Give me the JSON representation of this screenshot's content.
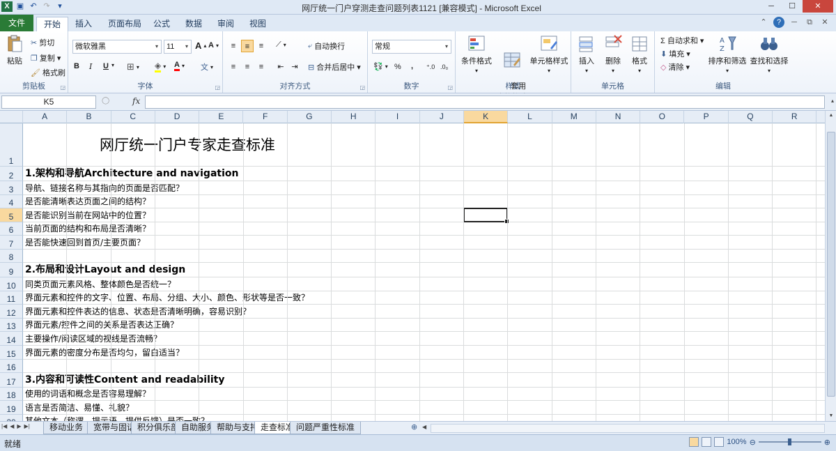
{
  "window": {
    "title": "网厅统一门户穿测走查问题列表1121 [兼容模式] - Microsoft Excel",
    "buttons": [
      "─",
      "☐",
      "✕"
    ]
  },
  "ribbon_tabs": [
    {
      "label": "文件"
    },
    {
      "label": "开始"
    },
    {
      "label": "插入"
    },
    {
      "label": "页面布局"
    },
    {
      "label": "公式"
    },
    {
      "label": "数据"
    },
    {
      "label": "审阅"
    },
    {
      "label": "视图"
    }
  ],
  "ribbon": {
    "clipboard": {
      "paste": "粘贴",
      "cut": "剪切",
      "copy": "复制 ▾",
      "format_painter": "格式刷",
      "label": "剪贴板"
    },
    "font": {
      "name": "微软雅黑",
      "size": "11",
      "grow": "A",
      "shrink": "A",
      "bold": "B",
      "italic": "I",
      "underline": "U",
      "label": "字体"
    },
    "alignment": {
      "wrap": "自动换行",
      "merge": "合并后居中 ▾",
      "label": "对齐方式"
    },
    "number": {
      "format": "常规",
      "percent": "%",
      "comma": ",",
      "label": "数字"
    },
    "styles": {
      "conditional": "条件格式",
      "table": "套用\n表格格式",
      "cell_styles": "单元格样式",
      "label": "样式"
    },
    "cells": {
      "insert": "插入",
      "delete": "删除",
      "format": "格式",
      "label": "单元格"
    },
    "editing": {
      "autosum": "Σ 自动求和 ▾",
      "fill": "填充 ▾",
      "clear": "清除 ▾",
      "sort": "排序和筛选",
      "find": "查找和选择",
      "label": "编辑"
    }
  },
  "formula_bar": {
    "name_box": "K5",
    "fx": "fx",
    "content": ""
  },
  "columns": [
    "A",
    "B",
    "C",
    "D",
    "E",
    "F",
    "G",
    "H",
    "I",
    "J",
    "K",
    "L",
    "M",
    "N",
    "O",
    "P",
    "Q",
    "R"
  ],
  "selected_column": "K",
  "rows": [
    {
      "num": "1",
      "text": "网厅统一门户专家走查标准",
      "kind": "title"
    },
    {
      "num": "2",
      "text": "1.架构和导航Architecture and navigation",
      "kind": "heading"
    },
    {
      "num": "3",
      "text": "导航、链接名称与其指向的页面是否匹配？",
      "kind": "item"
    },
    {
      "num": "4",
      "text": "是否能清晰表达页面之间的结构？",
      "kind": "item"
    },
    {
      "num": "5",
      "text": "是否能识别当前在网站中的位置？",
      "kind": "item"
    },
    {
      "num": "6",
      "text": "当前页面的结构和布局是否清晰？",
      "kind": "item"
    },
    {
      "num": "7",
      "text": "是否能快速回到首页/主要页面？",
      "kind": "item"
    },
    {
      "num": "8",
      "text": "",
      "kind": "empty"
    },
    {
      "num": "9",
      "text": "2.布局和设计Layout and design",
      "kind": "heading"
    },
    {
      "num": "10",
      "text": "同类页面元素风格、整体颜色是否统一？",
      "kind": "item"
    },
    {
      "num": "11",
      "text": "界面元素和控件的文字、位置、布局、分组、大小、颜色、形状等是否一致？",
      "kind": "item"
    },
    {
      "num": "12",
      "text": "界面元素和控件表达的信息、状态是否清晰明确，容易识别？",
      "kind": "item"
    },
    {
      "num": "13",
      "text": "界面元素/控件之间的关系是否表达正确？",
      "kind": "item"
    },
    {
      "num": "14",
      "text": "主要操作/阅读区域的视线是否流畅？",
      "kind": "item"
    },
    {
      "num": "15",
      "text": "界面元素的密度分布是否均匀，留白适当？",
      "kind": "item"
    },
    {
      "num": "16",
      "text": "",
      "kind": "empty"
    },
    {
      "num": "17",
      "text": "3.内容和可读性Content and readability",
      "kind": "heading"
    },
    {
      "num": "18",
      "text": "使用的词语和概念是否容易理解？",
      "kind": "item"
    },
    {
      "num": "19",
      "text": "语言是否简洁、易懂、礼貌？",
      "kind": "item"
    },
    {
      "num": "20",
      "text": "其他文本（称谓、提示语、提供反馈）是否一致？",
      "kind": "item"
    }
  ],
  "sheet_tabs": [
    {
      "label": "移动业务"
    },
    {
      "label": "宽带与固话"
    },
    {
      "label": "积分俱乐部"
    },
    {
      "label": "自助服务"
    },
    {
      "label": "帮助与支持"
    },
    {
      "label": "走查标准"
    },
    {
      "label": "问题严重性标准"
    }
  ],
  "active_sheet": "走查标准",
  "status": {
    "text": "就绪",
    "zoom": "100%"
  }
}
